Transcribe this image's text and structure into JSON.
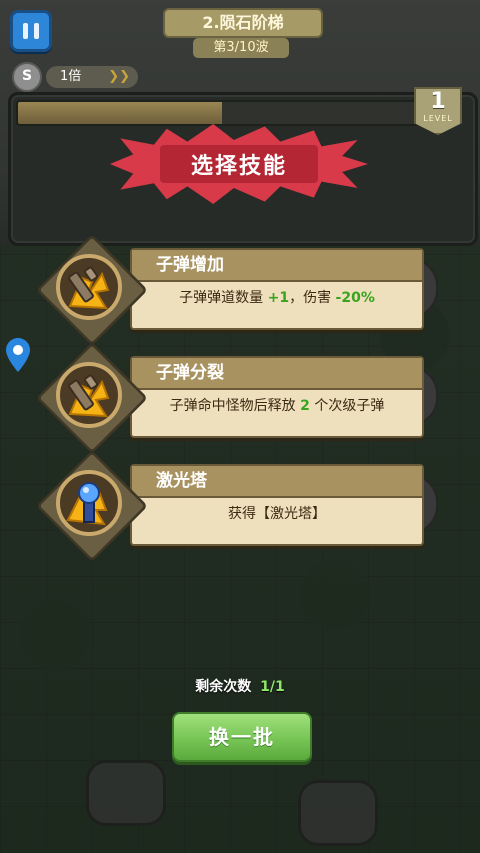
{
  "hud": {
    "level_title": "2.陨石阶梯",
    "wave": "第3/10波",
    "speed_label": "1倍",
    "speed_icon_glyph": "S",
    "speed_arrows": "❯❯",
    "level_number": "1",
    "level_word": "LEVEL",
    "xp_progress": 0.51
  },
  "banner": {
    "title": "选择技能"
  },
  "skills": [
    {
      "name": "子弹增加",
      "icon": "gun-icon",
      "desc_parts": [
        {
          "text": "子弹弹道数量 ",
          "hl": false
        },
        {
          "text": "+1",
          "hl": true
        },
        {
          "text": "，伤害 ",
          "hl": false
        },
        {
          "text": "-20%",
          "hl": true
        }
      ]
    },
    {
      "name": "子弹分裂",
      "icon": "gun-icon",
      "desc_parts": [
        {
          "text": "子弹命中怪物后释放 ",
          "hl": false
        },
        {
          "text": "2",
          "hl": true
        },
        {
          "text": " 个次级子弹",
          "hl": false
        }
      ]
    },
    {
      "name": "激光塔",
      "icon": "laser-tower-icon",
      "desc_parts": [
        {
          "text": "获得【激光塔】",
          "hl": false
        }
      ]
    }
  ],
  "footer": {
    "remaining_label": "剩余次数",
    "remaining_count": "1/1",
    "refresh_label": "换一批"
  },
  "colors": {
    "highlight": "#39a41d",
    "banner_red": "#d83a4a",
    "button_green": "#77c555",
    "card_bg": "#efe0bd",
    "card_header": "#a89260"
  }
}
